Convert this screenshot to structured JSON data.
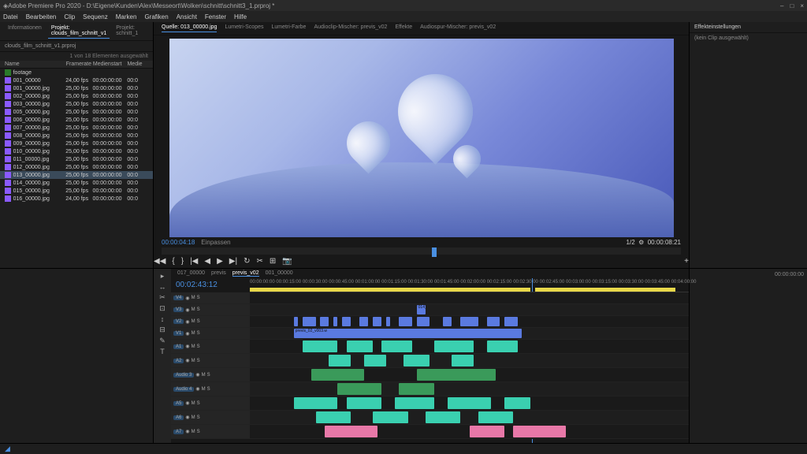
{
  "title": "Adobe Premiere Pro 2020 - D:\\Eigene\\Kunden\\Alex\\Messeort\\Wolken\\schnitt\\schnitt3_1.prproj *",
  "window_controls": [
    "–",
    "□",
    "×"
  ],
  "menu": [
    "Datei",
    "Bearbeiten",
    "Clip",
    "Sequenz",
    "Marken",
    "Grafiken",
    "Ansicht",
    "Fenster",
    "Hilfe"
  ],
  "project": {
    "tabs": [
      "Informationen",
      "Projekt: clouds_film_schnitt_v1",
      "Projekt: schnitt_1"
    ],
    "active_tab": 1,
    "bin_title": "clouds_film_schnitt_v1.prproj",
    "item_count": "1 von 18 Elementen ausgewählt",
    "columns": [
      "Name",
      "Framerate",
      "Medienstart",
      "Medie"
    ],
    "rows": [
      {
        "type": "folder",
        "name": "footage",
        "fr": "",
        "ms": "",
        "me": ""
      },
      {
        "name": "001_00000",
        "fr": "24,00 fps",
        "ms": "00:00:00:00",
        "me": "00:0"
      },
      {
        "name": "001_00000.jpg",
        "fr": "25,00 fps",
        "ms": "00:00:00:00",
        "me": "00:0"
      },
      {
        "name": "002_00000.jpg",
        "fr": "25,00 fps",
        "ms": "00:00:00:00",
        "me": "00:0"
      },
      {
        "name": "003_00000.jpg",
        "fr": "25,00 fps",
        "ms": "00:00:00:00",
        "me": "00:0"
      },
      {
        "name": "005_00000.jpg",
        "fr": "25,00 fps",
        "ms": "00:00:00:00",
        "me": "00:0"
      },
      {
        "name": "006_00000.jpg",
        "fr": "25,00 fps",
        "ms": "00:00:00:00",
        "me": "00:0"
      },
      {
        "name": "007_00000.jpg",
        "fr": "25,00 fps",
        "ms": "00:00:00:00",
        "me": "00:0"
      },
      {
        "name": "008_00000.jpg",
        "fr": "25,00 fps",
        "ms": "00:00:00:00",
        "me": "00:0"
      },
      {
        "name": "009_00000.jpg",
        "fr": "25,00 fps",
        "ms": "00:00:00:00",
        "me": "00:0"
      },
      {
        "name": "010_00000.jpg",
        "fr": "25,00 fps",
        "ms": "00:00:00:00",
        "me": "00:0"
      },
      {
        "name": "011_00000.jpg",
        "fr": "25,00 fps",
        "ms": "00:00:00:00",
        "me": "00:0"
      },
      {
        "name": "012_00000.jpg",
        "fr": "25,00 fps",
        "ms": "00:00:00:00",
        "me": "00:0"
      },
      {
        "name": "013_00000.jpg",
        "fr": "25,00 fps",
        "ms": "00:00:00:00",
        "me": "00:0",
        "selected": true
      },
      {
        "name": "014_00000.jpg",
        "fr": "25,00 fps",
        "ms": "00:00:00:00",
        "me": "00:0"
      },
      {
        "name": "015_00000.jpg",
        "fr": "25,00 fps",
        "ms": "00:00:00:00",
        "me": "00:0"
      },
      {
        "name": "016_00000.jpg",
        "fr": "24,00 fps",
        "ms": "00:00:00:00",
        "me": "00:0"
      }
    ]
  },
  "source": {
    "tabs": [
      "Quelle: 013_00000.jpg",
      "Lumetri-Scopes",
      "Lumetri-Farbe",
      "Audioclip-Mischer: previs_v02",
      "Effekte",
      "Audiospur-Mischer: previs_v02"
    ],
    "tc_in": "00:00:04:18",
    "fit": "Einpassen",
    "scale": "1/2",
    "tc_out": "00:00:08:21",
    "transport": [
      "◀◀",
      "{",
      "}",
      "|◀",
      "◀",
      "▶",
      "▶|",
      "↻",
      "✂",
      "⊞",
      "📷"
    ]
  },
  "effects": {
    "tab": "Effekteinstellungen",
    "empty": "(kein Clip ausgewählt)",
    "tc": "00:00:00:00"
  },
  "timeline": {
    "seq_tabs": [
      "017_00000",
      "previs",
      "previs_v02",
      "001_00000"
    ],
    "active_seq": 2,
    "master_tc": "00:02:43:12",
    "ruler": [
      "00:00:00:00",
      "00:00:15:00",
      "00:00:30:00",
      "00:00:45:00",
      "00:01:00:00",
      "00:01:15:00",
      "00:01:30:00",
      "00:01:45:00",
      "00:02:00:00",
      "00:02:15:00",
      "00:02:30:00",
      "00:02:45:00",
      "00:03:00:00",
      "00:03:15:00",
      "00:03:30:00",
      "00:03:45:00",
      "00:04:00:00"
    ],
    "tools": [
      "▸",
      "↔",
      "✂",
      "⊡",
      "↕",
      "⊟",
      "✎",
      "T",
      "⊞"
    ],
    "video_tracks": [
      "V4",
      "V3",
      "V2",
      "V1"
    ],
    "audio_tracks": [
      "A1",
      "A2",
      "Audio 3",
      "Audio 4",
      "A5",
      "A6",
      "A7"
    ],
    "track_controls": [
      "M",
      "S",
      "◉"
    ],
    "clip_label": "014_0000",
    "clip_label2": "previs_02_v003.w"
  }
}
